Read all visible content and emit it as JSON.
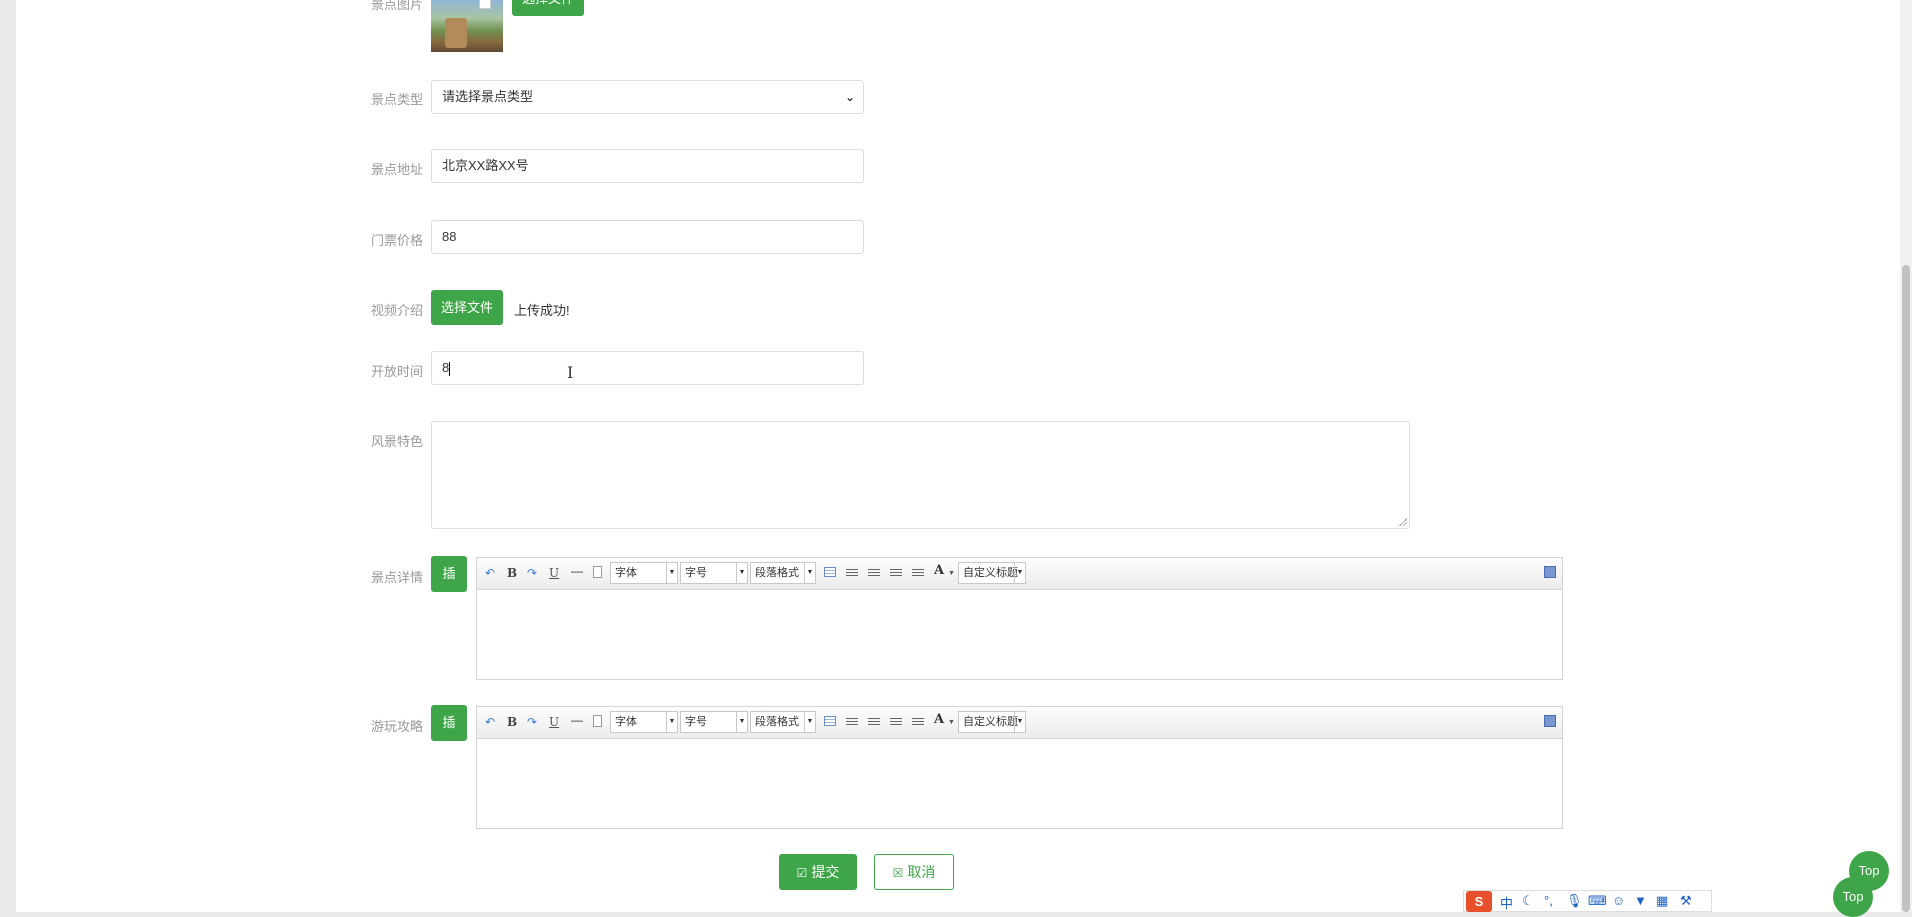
{
  "form": {
    "image": {
      "label": "景点图片",
      "button": "选择文件"
    },
    "type": {
      "label": "景点类型",
      "placeholder": "请选择景点类型"
    },
    "address": {
      "label": "景点地址",
      "value": "北京XX路XX号"
    },
    "price": {
      "label": "门票价格",
      "value": "88"
    },
    "video": {
      "label": "视频介绍",
      "button": "选择文件",
      "status": "上传成功!"
    },
    "open_time": {
      "label": "开放时间",
      "value": "8"
    },
    "features": {
      "label": "风景特色",
      "value": ""
    },
    "details": {
      "label": "景点详情",
      "insert_button": "插"
    },
    "guide": {
      "label": "游玩攻略",
      "insert_button": "插"
    }
  },
  "editor_toolbar": {
    "bold": "B",
    "underline": "U",
    "hr": "—",
    "font_family": "字体",
    "font_size": "字号",
    "paragraph": "段落格式",
    "font_color": "A",
    "custom_title": "自定义标题"
  },
  "actions": {
    "submit": "提交",
    "cancel": "取消"
  },
  "floating": {
    "top_button": "Top"
  },
  "ime": {
    "logo": "S",
    "mode": "中"
  },
  "colors": {
    "primary_green": "#3ea548"
  }
}
